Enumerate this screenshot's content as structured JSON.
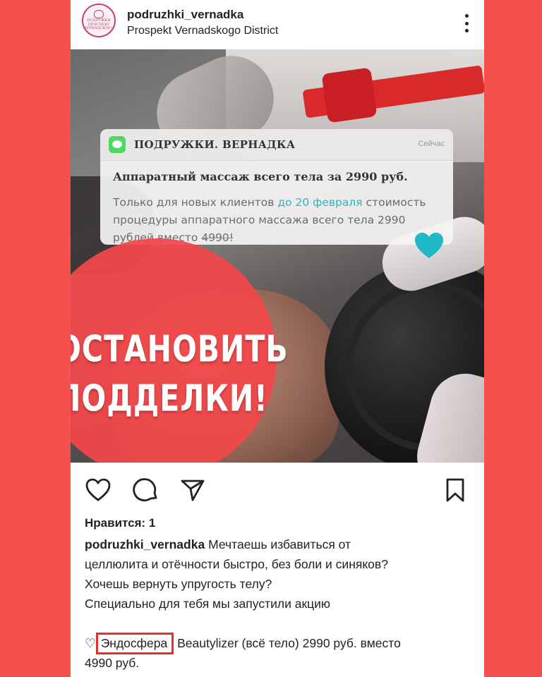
{
  "header": {
    "username": "podruzhki_vernadka",
    "location": "Prospekt Vernadskogo District",
    "avatar_text": [
      "ПОДРУЖКИ",
      "ПРОСПЕКТ",
      "ВЕРНАДСКОГО"
    ]
  },
  "notification": {
    "app_name": "ПОДРУЖКИ. ВЕРНАДКА",
    "time": "Сейчас",
    "title": "Аппаратный массаж всего тела за 2990 руб.",
    "body_1": "Только для новых клиентов ",
    "body_date": "до 20 февраля",
    "body_2": " стоимость процедуры аппаратного массажа всего тела 2990 рублей вместо ",
    "body_old_price": "4990!",
    "icon": "message-icon",
    "accent_color": "#2fb6c3"
  },
  "overlay": {
    "line1": "ОСТАНОВИТЬ",
    "line2": "ПОДДЕЛКИ!",
    "sign_color": "#f1474a"
  },
  "post": {
    "likes": "Нравится: 1",
    "caption_user": "podruzhki_vernadka",
    "caption_lines": [
      "Мечтаешь избавиться от",
      "целлюлита и отёчности быстро, без боли и синяков?",
      "Хочешь вернуть упругость телу?",
      "Специально для тебя мы запустили акцию"
    ],
    "promo_prefix": "♡",
    "promo_highlight": "Эндосфера",
    "promo_rest": " Beautylizer (всё тело) 2990 руб. вместо",
    "promo_line2": "4990 руб."
  },
  "colors": {
    "background": "#f4504d",
    "highlight_box": "#e8302a"
  }
}
